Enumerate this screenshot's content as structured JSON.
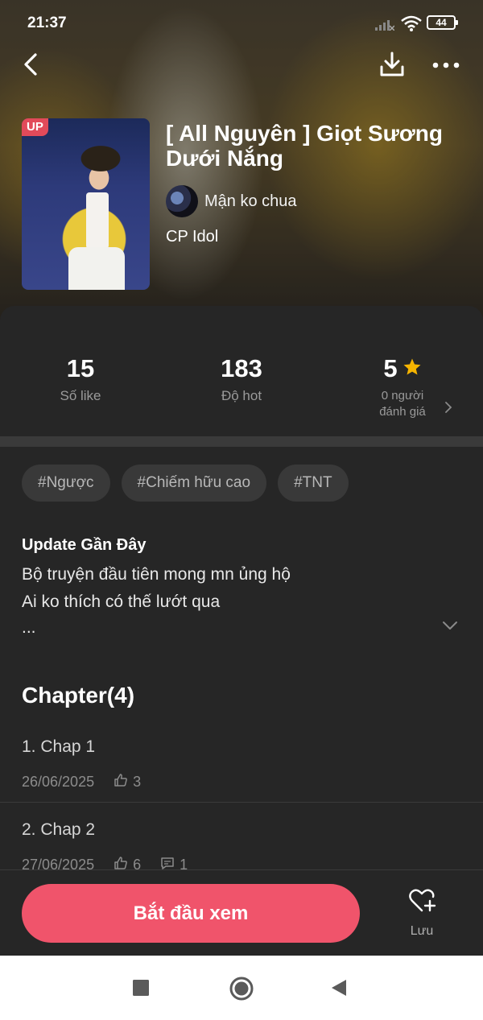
{
  "status_bar": {
    "time": "21:37",
    "battery": "44"
  },
  "story": {
    "badge": "UP",
    "title": "[ All Nguyên ] Giọt Sương Dưới Nắng",
    "author": "Mận ko chua",
    "category": "CP Idol"
  },
  "stats": {
    "likes": {
      "value": "15",
      "label": "Số like"
    },
    "hot": {
      "value": "183",
      "label": "Độ hot"
    },
    "rating": {
      "value": "5",
      "label_line1": "0 người",
      "label_line2": "đánh giá"
    }
  },
  "tags": [
    "#Ngược",
    "#Chiếm hữu cao",
    "#TNT"
  ],
  "update": {
    "title": "Update Gần Đây",
    "lines": [
      "Bộ truyện đầu tiên mong mn ủng hộ",
      "Ai ko thích có thế lướt qua",
      "..."
    ]
  },
  "chapters": {
    "heading": "Chapter(4)",
    "items": [
      {
        "title": "1. Chap 1",
        "date": "26/06/2025",
        "likes": "3",
        "comments": ""
      },
      {
        "title": "2. Chap 2",
        "date": "27/06/2025",
        "likes": "6",
        "comments": "1"
      }
    ]
  },
  "actions": {
    "start": "Bắt đầu xem",
    "save": "Lưu"
  },
  "colors": {
    "accent": "#f0546b",
    "badge": "#e24a5a",
    "star": "#f5b400",
    "background": "#262626"
  },
  "icons": [
    "back-icon",
    "download-icon",
    "more-icon",
    "star-icon",
    "chevron-right-icon",
    "chevron-down-icon",
    "thumbs-up-icon",
    "comment-icon",
    "heart-plus-icon",
    "square-icon",
    "circle-home-icon",
    "triangle-back-icon"
  ]
}
